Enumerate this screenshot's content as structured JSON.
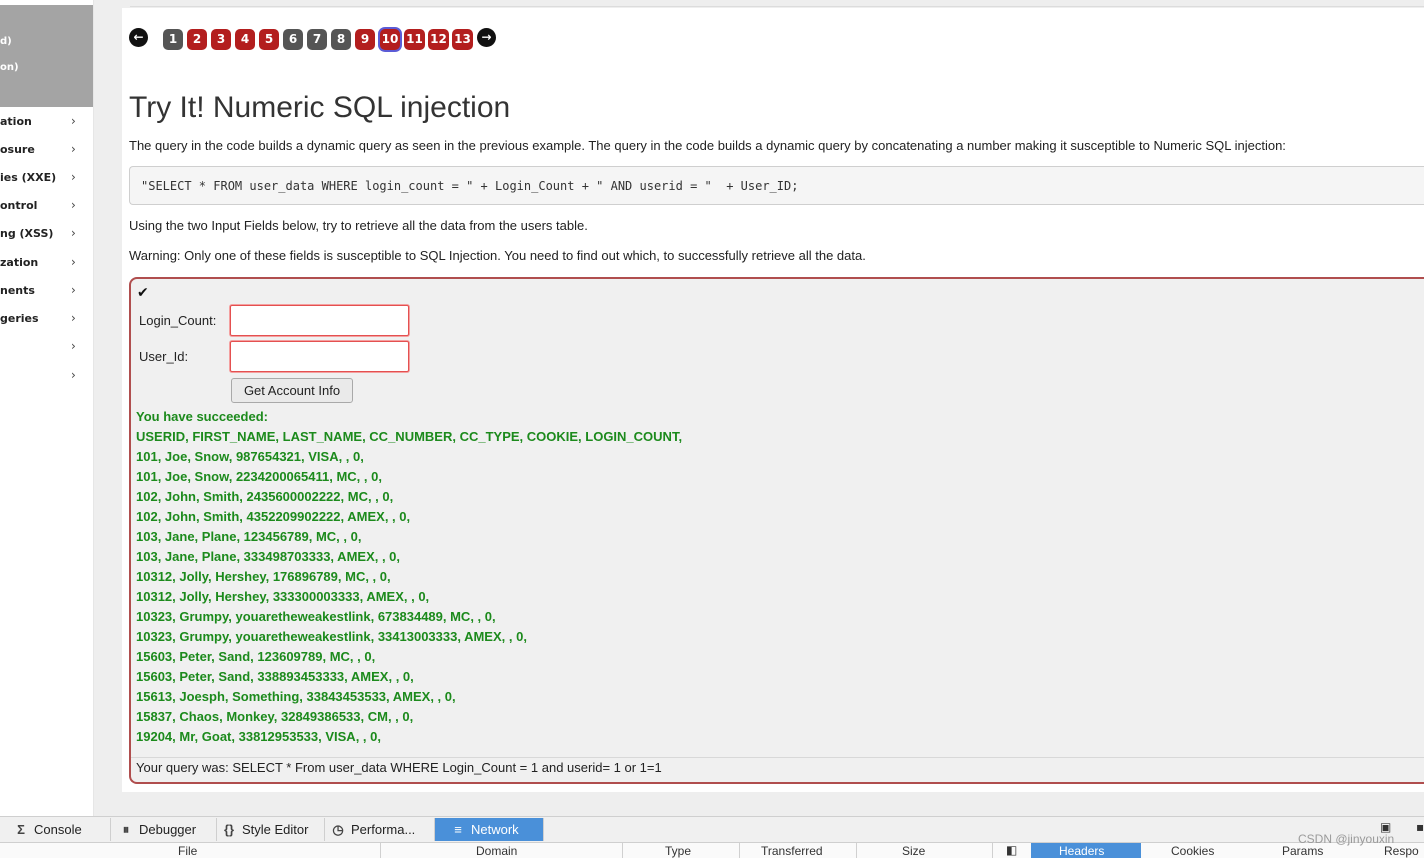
{
  "sidebar": {
    "top_lines": [
      "d)",
      "on)"
    ],
    "items": [
      {
        "label": "ation"
      },
      {
        "label": "osure"
      },
      {
        "label": "ies (XXE)"
      },
      {
        "label": "ontrol"
      },
      {
        "label": "ng (XSS)"
      },
      {
        "label": "zation"
      },
      {
        "label": "nents"
      },
      {
        "label": "geries"
      },
      {
        "label": ""
      },
      {
        "label": ""
      }
    ],
    "chevron": "›"
  },
  "pagination": {
    "prev": "←",
    "next": "→",
    "pages": [
      "1",
      "2",
      "3",
      "4",
      "5",
      "6",
      "7",
      "8",
      "9",
      "10",
      "11",
      "12",
      "13"
    ],
    "current": "10"
  },
  "lesson": {
    "title": "Try It! Numeric SQL injection",
    "intro": "The query in the code builds a dynamic query as seen in the previous example. The query in the code builds a dynamic query by concatenating a number making it susceptible to Numeric SQL injection:",
    "code": "\"SELECT * FROM user_data WHERE login_count = \" + Login_Count + \" AND userid = \"  + User_ID;",
    "instruction": "Using the two Input Fields below, try to retrieve all the data from the users table.",
    "warning": "Warning: Only one of these fields is susceptible to SQL Injection. You need to find out which, to successfully retrieve all the data."
  },
  "form": {
    "check_icon": "✔",
    "login_count_label": "Login_Count:",
    "login_count_value": "",
    "user_id_label": "User_Id:",
    "user_id_value": "",
    "submit_label": "Get Account Info"
  },
  "feedback": {
    "lines": [
      "You have succeeded:",
      "USERID, FIRST_NAME, LAST_NAME, CC_NUMBER, CC_TYPE, COOKIE, LOGIN_COUNT,",
      "101, Joe, Snow, 987654321, VISA, , 0,",
      "101, Joe, Snow, 2234200065411, MC, , 0,",
      "102, John, Smith, 2435600002222, MC, , 0,",
      "102, John, Smith, 4352209902222, AMEX, , 0,",
      "103, Jane, Plane, 123456789, MC, , 0,",
      "103, Jane, Plane, 333498703333, AMEX, , 0,",
      "10312, Jolly, Hershey, 176896789, MC, , 0,",
      "10312, Jolly, Hershey, 333300003333, AMEX, , 0,",
      "10323, Grumpy, youaretheweakestlink, 673834489, MC, , 0,",
      "10323, Grumpy, youaretheweakestlink, 33413003333, AMEX, , 0,",
      "15603, Peter, Sand, 123609789, MC, , 0,",
      "15603, Peter, Sand, 338893453333, AMEX, , 0,",
      "15613, Joesph, Something, 33843453533, AMEX, , 0,",
      "15837, Chaos, Monkey, 32849386533, CM, , 0,",
      "19204, Mr, Goat, 33812953533, VISA, , 0,"
    ],
    "query": "Your query was: SELECT * From user_data WHERE Login_Count = 1 and userid= 1 or 1=1"
  },
  "devtools": {
    "tabs": [
      {
        "icon": "Σ",
        "label": "Console"
      },
      {
        "icon": "⏸",
        "label": "Debugger"
      },
      {
        "icon": "{}",
        "label": "Style Editor"
      },
      {
        "icon": "◷",
        "label": "Performa..."
      },
      {
        "icon": "≡",
        "label": "Network"
      }
    ],
    "active_tab": "Network",
    "columns": [
      "File",
      "Domain",
      "Type",
      "Transferred",
      "Size"
    ],
    "detail_tabs": [
      "Headers",
      "Cookies",
      "Params",
      "Respo"
    ]
  },
  "watermark": "CSDN @jinyouxin",
  "colors": {
    "accent_red": "#b31e1e",
    "success_green": "#1c8a1c",
    "active_tab": "#4a90d9"
  }
}
